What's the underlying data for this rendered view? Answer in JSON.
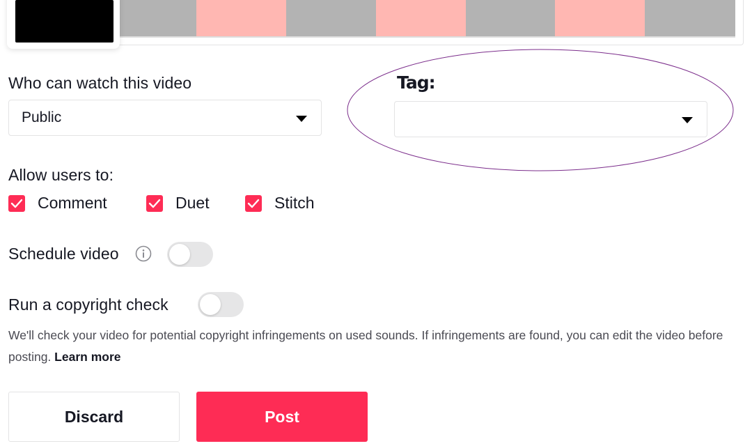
{
  "thumbnail_strip": {
    "segment_colors": [
      "#b3b3b3",
      "#ffb7b2",
      "#b3b3b3",
      "#ffb7b2",
      "#b3b3b3",
      "#ffb7b2",
      "#b3b3b3"
    ]
  },
  "privacy": {
    "label": "Who can watch this video",
    "selected": "Public"
  },
  "tag": {
    "label": "Tag:",
    "selected": "",
    "annotation_color": "#7b2d8b"
  },
  "permissions": {
    "label": "Allow users to:",
    "options": [
      {
        "label": "Comment",
        "checked": true
      },
      {
        "label": "Duet",
        "checked": true
      },
      {
        "label": "Stitch",
        "checked": true
      }
    ]
  },
  "schedule": {
    "label": "Schedule video",
    "icon": "info-icon",
    "enabled": false
  },
  "copyright": {
    "label": "Run a copyright check",
    "enabled": false,
    "description": "We'll check your video for potential copyright infringements on used sounds. If infringements are found, you can edit the video before posting.",
    "learn_more": "Learn more"
  },
  "actions": {
    "discard_label": "Discard",
    "post_label": "Post"
  },
  "colors": {
    "accent": "#fe2c55",
    "toggle_off": "#e6e6e7",
    "text": "#161823"
  }
}
